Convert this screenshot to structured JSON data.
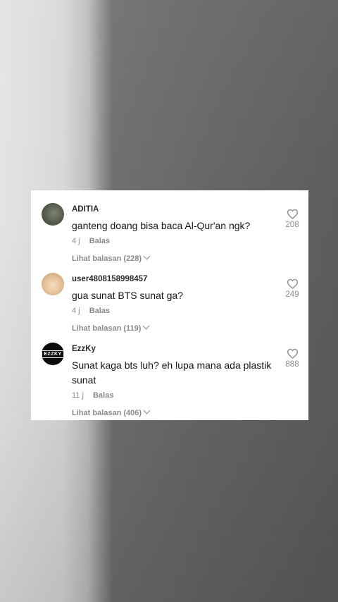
{
  "comments": [
    {
      "username": "ADITIA",
      "text": "ganteng doang bisa baca Al-Qur'an ngk?",
      "time": "4 j",
      "reply_label": "Balas",
      "replies_label": "Lihat balasan (228)",
      "likes": "208",
      "avatar": "photo-avatar-dark"
    },
    {
      "username": "user4808158998457",
      "text": "gua sunat BTS sunat ga?",
      "time": "4 j",
      "reply_label": "Balas",
      "replies_label": "Lihat balasan (119)",
      "likes": "249",
      "avatar": "photo-avatar-face"
    },
    {
      "username": "EzzKy",
      "text": "Sunat kaga bts luh? eh lupa mana ada plastik sunat",
      "time": "11 j",
      "reply_label": "Balas",
      "replies_label": "Lihat balasan (406)",
      "likes": "888",
      "avatar": "logo-avatar-black"
    }
  ],
  "icons": {
    "like": "heart-outline-icon",
    "expand": "chevron-down-icon"
  },
  "colors": {
    "card_bg": "#ffffff",
    "text_primary": "#161616",
    "text_secondary": "#8a8a8a"
  }
}
